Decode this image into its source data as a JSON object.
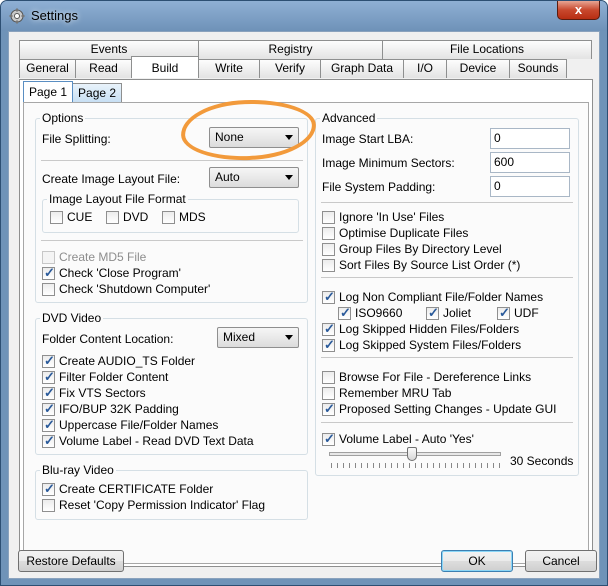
{
  "window": {
    "title": "Settings",
    "close_label": "x"
  },
  "tabs_top": [
    "Events",
    "Registry",
    "File Locations"
  ],
  "tabs_bottom": [
    "General",
    "Read",
    "Build",
    "Write",
    "Verify",
    "Graph Data",
    "I/O",
    "Device",
    "Sounds"
  ],
  "subtabs": [
    "Page 1",
    "Page 2"
  ],
  "options": {
    "title": "Options",
    "file_splitting_label": "File Splitting:",
    "file_splitting_value": "None",
    "image_layout_label": "Create Image Layout File:",
    "image_layout_value": "Auto",
    "format_group_title": "Image Layout File Format",
    "formats": [
      "CUE",
      "DVD",
      "MDS"
    ],
    "md5_label": "Create MD5 File",
    "close_program_label": "Check 'Close Program'",
    "shutdown_label": "Check 'Shutdown Computer'"
  },
  "dvd": {
    "title": "DVD Video",
    "folder_location_label": "Folder Content Location:",
    "folder_location_value": "Mixed",
    "items": [
      "Create AUDIO_TS Folder",
      "Filter Folder Content",
      "Fix VTS Sectors",
      "IFO/BUP 32K Padding",
      "Uppercase File/Folder Names",
      "Volume Label - Read DVD Text Data"
    ]
  },
  "bluray": {
    "title": "Blu-ray Video",
    "items": [
      "Create CERTIFICATE Folder",
      "Reset 'Copy Permission Indicator' Flag"
    ]
  },
  "advanced": {
    "title": "Advanced",
    "start_lba_label": "Image Start LBA:",
    "start_lba_value": "0",
    "min_sectors_label": "Image Minimum Sectors:",
    "min_sectors_value": "600",
    "fs_padding_label": "File System Padding:",
    "fs_padding_value": "0",
    "group1": [
      "Ignore 'In Use' Files",
      "Optimise Duplicate Files",
      "Group Files By Directory Level",
      "Sort Files By Source List Order (*)"
    ],
    "log_noncompliant": "Log Non Compliant File/Folder Names",
    "fs_types": [
      "ISO9660",
      "Joliet",
      "UDF"
    ],
    "log_hidden": "Log Skipped Hidden Files/Folders",
    "log_system": "Log Skipped System Files/Folders",
    "group3": [
      "Browse For File - Dereference Links",
      "Remember MRU Tab",
      "Proposed Setting Changes - Update GUI"
    ],
    "volume_label_auto": "Volume Label - Auto 'Yes'",
    "slider_value_text": "30 Seconds",
    "slider_fraction": 0.48
  },
  "buttons": {
    "restore": "Restore Defaults",
    "ok": "OK",
    "cancel": "Cancel"
  },
  "colors": {
    "highlight": "#f29a3b",
    "titlebar": "#6e92b8",
    "close": "#c8482d"
  }
}
